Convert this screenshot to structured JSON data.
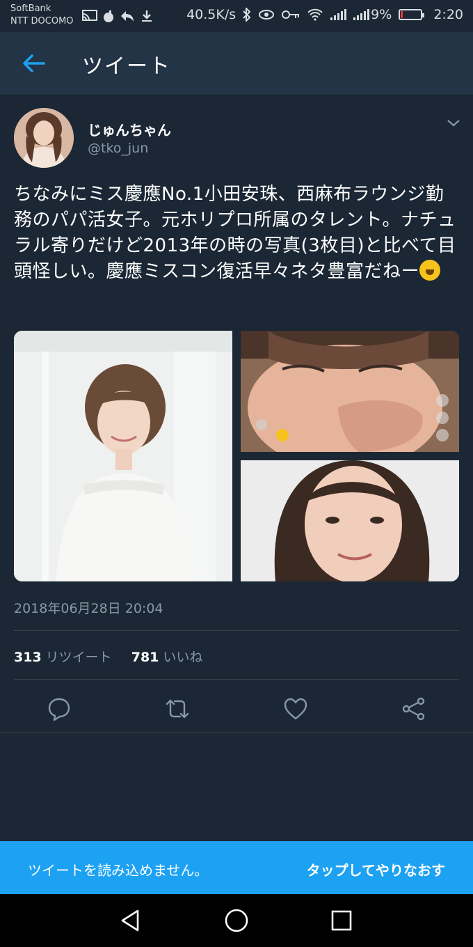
{
  "status_bar": {
    "carrier_1": "SoftBank",
    "carrier_2": "NTT DOCOMO",
    "network_speed": "40.5K/s",
    "battery": "9%",
    "battery_level": 0.09,
    "time": "2:20"
  },
  "header": {
    "title": "ツイート"
  },
  "tweet": {
    "display_name": "じゅんちゃん",
    "handle": "@tko_jun",
    "text": "ちなみにミス慶應No.1小田安珠、西麻布ラウンジ勤務のパパ活女子。元ホリプロ所属のタレント。ナチュラル寄りだけど2013年の時の写真(3枚目)と比べて目頭怪しい。慶應ミスコン復活早々ネタ豊富だねー",
    "emoji": "rolling-on-floor-laughing",
    "timestamp": "2018年06月28日 20:04",
    "retweet_count": "313",
    "retweet_label": "リツイート",
    "like_count": "781",
    "like_label": "いいね"
  },
  "snackbar": {
    "message": "ツイートを読み込めません。",
    "action": "タップしてやりなおす"
  },
  "colors": {
    "background": "#1b2734",
    "appbar": "#243447",
    "accent": "#1da1f2",
    "secondary_text": "#8899a6"
  }
}
